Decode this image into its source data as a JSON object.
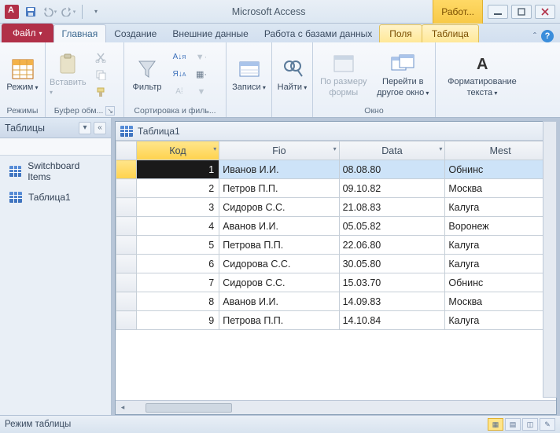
{
  "title": "Microsoft Access",
  "context_tab": "Работ...",
  "file_tab": "Файл",
  "tabs": [
    "Главная",
    "Создание",
    "Внешние данные",
    "Работа с базами данных"
  ],
  "active_tab": 0,
  "context_sub_tabs": [
    "Поля",
    "Таблица"
  ],
  "ribbon": {
    "view": {
      "label": "Режим",
      "group": "Режимы"
    },
    "paste": {
      "label": "Вставить",
      "group": "Буфер обм..."
    },
    "filter": {
      "label": "Фильтр",
      "group": "Сортировка и филь..."
    },
    "records": {
      "label": "Записи"
    },
    "find": {
      "label": "Найти"
    },
    "sizeform": {
      "label1": "По размеру",
      "label2": "формы"
    },
    "switchwin": {
      "label1": "Перейти в",
      "label2": "другое окно"
    },
    "window_group": "Окно",
    "format": {
      "label1": "Форматирование",
      "label2": "текста",
      "group": ""
    }
  },
  "nav": {
    "header": "Таблицы",
    "items": [
      "Switchboard Items",
      "Таблица1"
    ]
  },
  "datasheet": {
    "title": "Таблица1",
    "columns": [
      "Код",
      "Fio",
      "Data",
      "Mest"
    ],
    "selected_col": 0,
    "selected_row": 0,
    "rows": [
      {
        "id": 1,
        "fio": "Иванов И.И.",
        "data": "08.08.80",
        "mesto": "Обнинс"
      },
      {
        "id": 2,
        "fio": "Петров П.П.",
        "data": "09.10.82",
        "mesto": "Москва"
      },
      {
        "id": 3,
        "fio": "Сидоров С.С.",
        "data": "21.08.83",
        "mesto": "Калуга"
      },
      {
        "id": 4,
        "fio": "Аванов И.И.",
        "data": "05.05.82",
        "mesto": "Воронеж"
      },
      {
        "id": 5,
        "fio": "Петрова П.П.",
        "data": "22.06.80",
        "mesto": "Калуга"
      },
      {
        "id": 6,
        "fio": "Сидорова С.С.",
        "data": "30.05.80",
        "mesto": "Калуга"
      },
      {
        "id": 7,
        "fio": "Сидоров С.С.",
        "data": "15.03.70",
        "mesto": "Обнинс"
      },
      {
        "id": 8,
        "fio": "Аванов И.И.",
        "data": "14.09.83",
        "mesto": "Москва"
      },
      {
        "id": 9,
        "fio": "Петрова П.П.",
        "data": "14.10.84",
        "mesto": "Калуга"
      }
    ]
  },
  "status": "Режим таблицы"
}
